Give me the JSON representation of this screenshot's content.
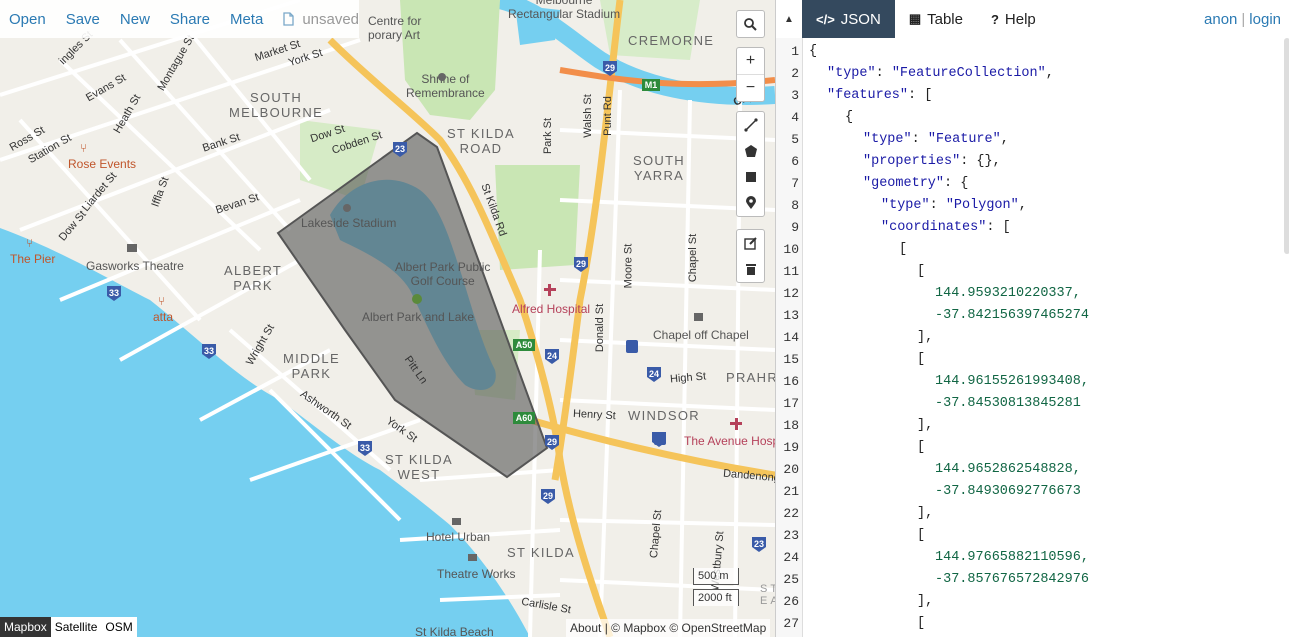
{
  "menu": {
    "items": [
      "Open",
      "Save",
      "New",
      "Share",
      "Meta"
    ],
    "file_status": "unsaved"
  },
  "map": {
    "suburbs": {
      "south_melbourne": "SOUTH\nMELBOURNE",
      "albert_park": "ALBERT\nPARK",
      "middle_park": "MIDDLE\nPARK",
      "st_kilda_west": "ST KILDA\nWEST",
      "st_kilda_road": "ST KILDA\nROAD",
      "south_yarra": "SOUTH\nYARRA",
      "cremorne": "CREMORNE",
      "windsor": "WINDSOR",
      "prahran": "PRAHR",
      "st_kilda": "ST KILDA"
    },
    "pois": {
      "rect_stadium": "Melbourne\nRectangular Stadium",
      "arts_centre": "Centre for\nporary Art",
      "shrine": "Shrine of\nRemembrance",
      "lakeside": "Lakeside Stadium",
      "golf": "Albert Park Public\nGolf Course",
      "albert_lake": "Albert Park and Lake",
      "rose_events": "Rose Events",
      "the_pier": "The Pier",
      "gasworks": "Gasworks Theatre",
      "atta": "atta",
      "alfred": "Alfred Hospital",
      "chapel_off": "Chapel off Chapel",
      "avenue_hosp": "The Avenue Hosp",
      "hotel_urban": "Hotel Urban",
      "theatre_works": "Theatre Works",
      "st_kilda_beach": "St Kilda Beach"
    },
    "roads": {
      "market": "Market St",
      "york1": "York St",
      "montague": "Montague St",
      "evans": "Evans St",
      "heath": "Heath St",
      "ross": "Ross St",
      "station": "Station St",
      "bank": "Bank St",
      "dow1": "Dow St",
      "cobden": "Cobden St",
      "liardet": "Liardet St",
      "iffla": "Iffla St",
      "bevan": "Bevan St",
      "dow2": "Dow St",
      "wright": "Wright St",
      "ashworth": "Ashworth St",
      "york2": "York St",
      "pitt": "Pitt Ln",
      "stkildard": "St Kilda Rd",
      "park": "Park St",
      "walsh": "Walsh St",
      "punt": "Punt Rd",
      "moore": "Moore St",
      "chapel1": "Chapel St",
      "donald": "Donald St",
      "high": "High St",
      "henry": "Henry St",
      "dandenong": "Dandenong",
      "chapel2": "Chapel St",
      "westbury": "Westbury St",
      "carlisle": "Carlisle St",
      "cityl": "CityL",
      "inglis": "ingles St",
      "stkilda_e": "S T\nE A"
    },
    "shields": [
      "29",
      "M1",
      "23",
      "29",
      "33",
      "33",
      "24",
      "24",
      "29",
      "29",
      "A50",
      "A60",
      "33",
      "23",
      "29"
    ],
    "layers": [
      "Mapbox",
      "Satellite",
      "OSM"
    ],
    "active_layer": "Mapbox",
    "scale": [
      "500 m",
      "2000 ft"
    ],
    "attribution": "About | © Mapbox © OpenStreetMap"
  },
  "panel": {
    "tabs": [
      {
        "icon": "</>",
        "label": "JSON"
      },
      {
        "icon": "▦",
        "label": "Table"
      },
      {
        "icon": "?",
        "label": "Help"
      }
    ],
    "auth": {
      "anon": "anon",
      "login": "login"
    },
    "line_numbers": [
      "1",
      "2",
      "3",
      "4",
      "5",
      "6",
      "7",
      "8",
      "9",
      "10",
      "11",
      "12",
      "13",
      "14",
      "15",
      "16",
      "17",
      "18",
      "19",
      "20",
      "21",
      "22",
      "23",
      "24",
      "25",
      "26",
      "27"
    ],
    "code": {
      "l1": "{",
      "l2k": "\"type\"",
      "l2v": "\"FeatureCollection\"",
      "l3k": "\"features\"",
      "l3v": "[",
      "l4": "{",
      "l5k": "\"type\"",
      "l5v": "\"Feature\"",
      "l6k": "\"properties\"",
      "l6v": "{},",
      "l7k": "\"geometry\"",
      "l7v": "{",
      "l8k": "\"type\"",
      "l8v": "\"Polygon\"",
      "l9k": "\"coordinates\"",
      "l9v": "[",
      "l10": "[",
      "l11": "[",
      "l12": "144.9593210220337,",
      "l13": "-37.842156397465274",
      "l14": "],",
      "l15": "[",
      "l16": "144.96155261993408,",
      "l17": "-37.84530813845281",
      "l18": "],",
      "l19": "[",
      "l20": "144.9652862548828,",
      "l21": "-37.84930692776673",
      "l22": "],",
      "l23": "[",
      "l24": "144.97665882110596,",
      "l25": "-37.857676572842976",
      "l26": "],",
      "l27": "["
    }
  }
}
